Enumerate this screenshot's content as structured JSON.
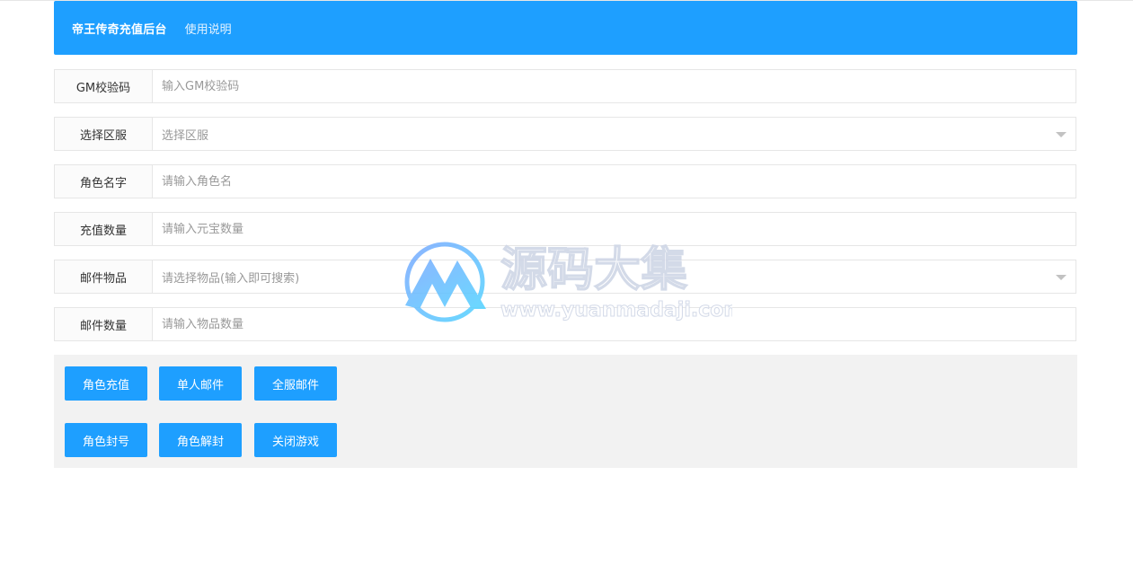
{
  "header": {
    "brand": "帝王传奇充值后台",
    "help_link": "使用说明"
  },
  "form": {
    "gm_code": {
      "label": "GM校验码",
      "placeholder": "输入GM校验码"
    },
    "server": {
      "label": "选择区服",
      "placeholder": "选择区服"
    },
    "role_name": {
      "label": "角色名字",
      "placeholder": "请输入角色名"
    },
    "recharge_amount": {
      "label": "充值数量",
      "placeholder": "请输入元宝数量"
    },
    "mail_item": {
      "label": "邮件物品",
      "placeholder": "请选择物品(输入即可搜索)"
    },
    "mail_quantity": {
      "label": "邮件数量",
      "placeholder": "请输入物品数量"
    }
  },
  "buttons": {
    "role_recharge": "角色充值",
    "single_mail": "单人邮件",
    "server_mail": "全服邮件",
    "ban_role": "角色封号",
    "unban_role": "角色解封",
    "close_game": "关闭游戏"
  },
  "watermark": {
    "title": "源码大集",
    "url": "www.yuanmadaji.com",
    "icon": "mountain-logo-icon"
  },
  "colors": {
    "primary": "#1e9fff",
    "panel_bg": "#f2f2f2",
    "border": "#e6e6e6"
  }
}
